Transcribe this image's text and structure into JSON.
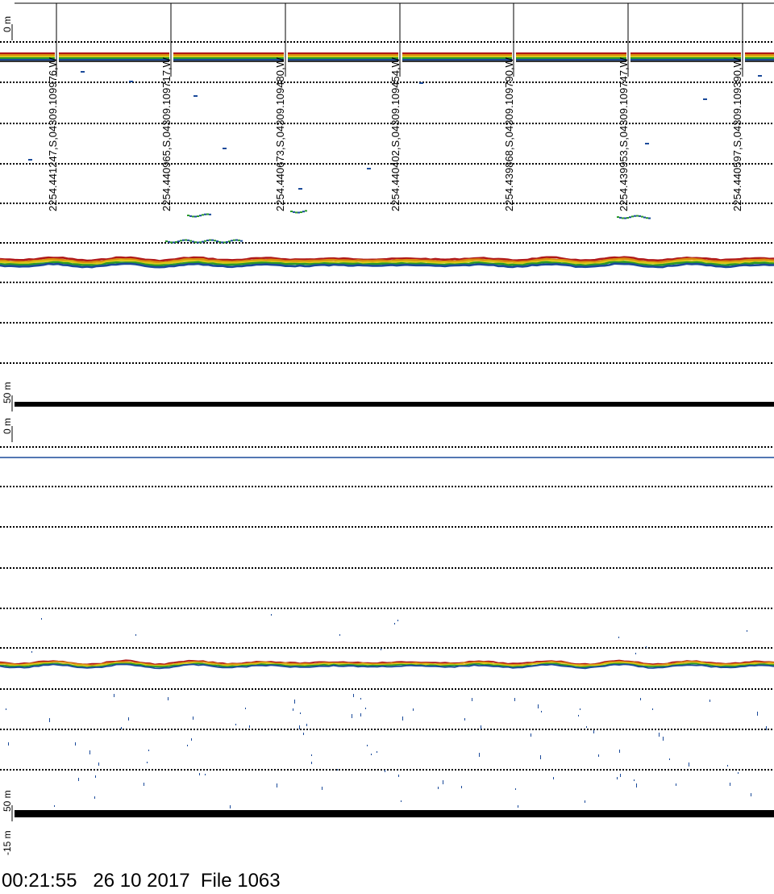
{
  "panel1": {
    "depth_top": "0  m",
    "depth_bottom": "50  m"
  },
  "panel2": {
    "depth_top": "0  m",
    "depth_bottom": "50  m",
    "depth_below": "-15  m"
  },
  "gps_markers": [
    "2254.441247,S,04309.109976,W",
    "2254.440965,S,04309.109717,W",
    "2254.440673,S,04309.109480,W",
    "2254.440402,S,04309.109454,W",
    "2254.439868,S,04309.109790,W",
    "2254.439953,S,04309.109747,W",
    "2254.440597,S,04309.109390,W"
  ],
  "footer": {
    "text": "00:21:55   26 10 2017  File 1063"
  },
  "colors": {
    "echo_red": "#b01818",
    "echo_orange": "#d88a10",
    "echo_yellow": "#d8c818",
    "echo_green": "#2a9a2a",
    "echo_blue": "#1a4a9a",
    "grid_line": "#000000",
    "background": "#ffffff"
  }
}
